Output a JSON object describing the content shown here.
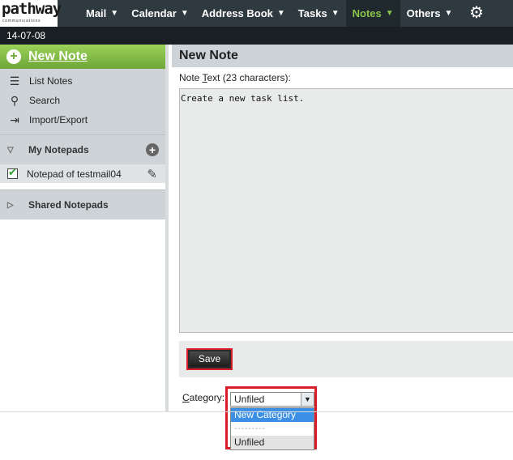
{
  "logo": {
    "word": "pathway",
    "sub": "communications"
  },
  "nav": {
    "items": [
      {
        "label": "Mail"
      },
      {
        "label": "Calendar"
      },
      {
        "label": "Address Book"
      },
      {
        "label": "Tasks"
      },
      {
        "label": "Notes",
        "active": true
      },
      {
        "label": "Others"
      }
    ],
    "settings_icon": "gear-icon"
  },
  "date": "14-07-08",
  "sidebar": {
    "new_note": "New Note",
    "links": [
      {
        "label": "List Notes",
        "icon": "list-icon"
      },
      {
        "label": "Search",
        "icon": "search-icon"
      },
      {
        "label": "Import/Export",
        "icon": "import-export-icon"
      }
    ],
    "my_notepads": "My Notepads",
    "notepad_item": "Notepad of testmail04",
    "shared_notepads": "Shared Notepads"
  },
  "main": {
    "title": "New Note",
    "note_label_prefix": "Note ",
    "note_label_underlined": "T",
    "note_label_rest": "ext (23 characters):",
    "note_text": "Create a new task list.",
    "save_label": "Save",
    "category_label_underlined": "C",
    "category_label_rest": "ategory:",
    "category_value": "Unfiled",
    "category_options": [
      "New Category",
      "---------",
      "Unfiled"
    ]
  },
  "colors": {
    "accent_green": "#8bc34a",
    "highlight_red": "#d81e2a",
    "select_blue": "#3b8fe4"
  }
}
